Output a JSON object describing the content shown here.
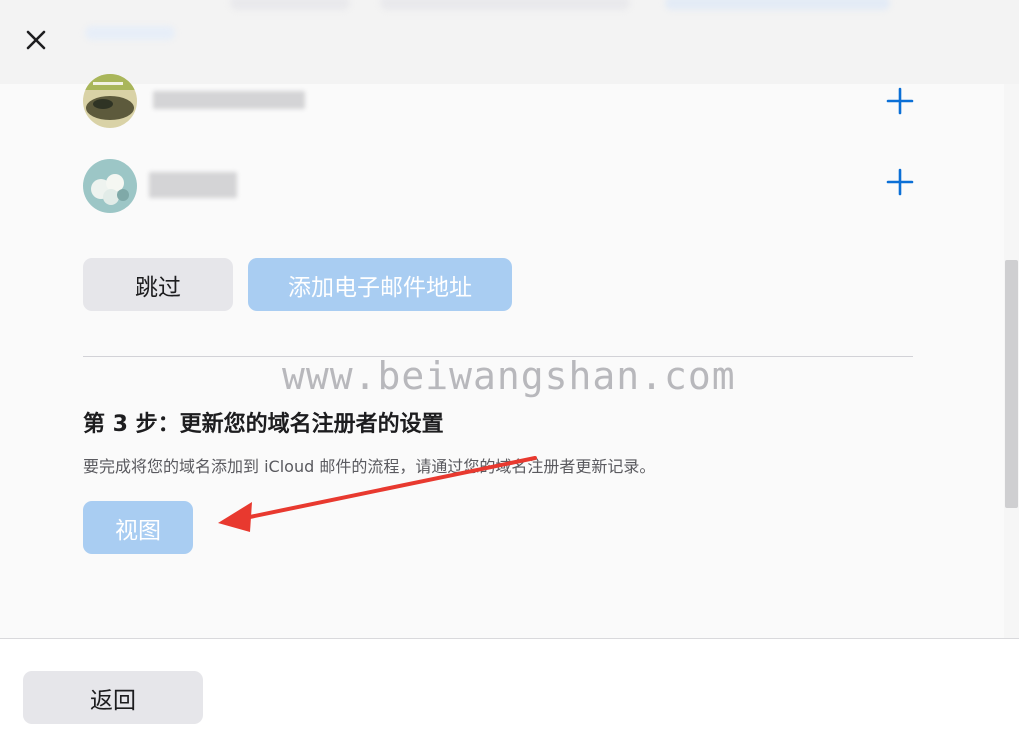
{
  "header": {
    "close_icon": "close-icon"
  },
  "recipients": [
    {
      "name_redacted": true,
      "avatar": "avatar-image",
      "action_icon": "plus-icon"
    },
    {
      "name_redacted": true,
      "avatar": "avatar-image",
      "action_icon": "plus-icon"
    }
  ],
  "buttons": {
    "skip": "跳过",
    "add_email": "添加电子邮件地址",
    "view": "视图",
    "back": "返回"
  },
  "watermark": "www.beiwangshan.com",
  "step3": {
    "title": "第 3 步：更新您的域名注册者的设置",
    "description": "要完成将您的域名添加到 iCloud 邮件的流程，请通过您的域名注册者更新记录。"
  },
  "colors": {
    "accent": "#0a6fd6",
    "button_disabled_blue": "#a9cdf2",
    "button_gray": "#e6e6ea",
    "arrow_red": "#e8392f"
  }
}
